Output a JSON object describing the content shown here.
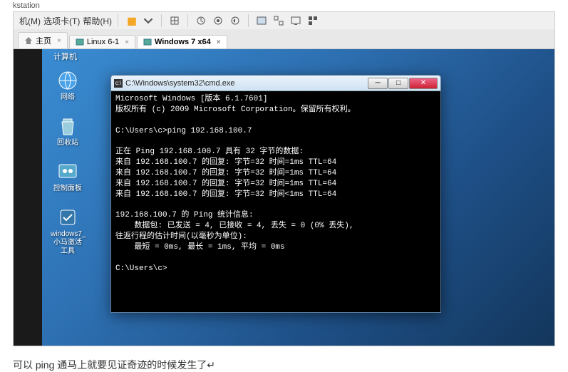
{
  "app_header": "kstation",
  "menu": {
    "item1": "机(M)",
    "item2": "选项卡(T)",
    "item3": "帮助(H)"
  },
  "tabs": {
    "home": "主页",
    "linux": "Linux 6-1",
    "win7": "Windows 7 x64"
  },
  "sec_title": "计算机",
  "desktop": {
    "network": "网络",
    "recycle": "回收站",
    "control": "控制面板",
    "tool": "windows7_小马激活工具"
  },
  "cmd": {
    "title": "C:\\Windows\\system32\\cmd.exe",
    "lines": [
      "Microsoft Windows [版本 6.1.7601]",
      "版权所有 (c) 2009 Microsoft Corporation。保留所有权利。",
      "",
      "C:\\Users\\c>ping 192.168.100.7",
      "",
      "正在 Ping 192.168.100.7 具有 32 字节的数据:",
      "来自 192.168.100.7 的回复: 字节=32 时间=1ms TTL=64",
      "来自 192.168.100.7 的回复: 字节=32 时间=1ms TTL=64",
      "来自 192.168.100.7 的回复: 字节=32 时间=1ms TTL=64",
      "来自 192.168.100.7 的回复: 字节=32 时间<1ms TTL=64",
      "",
      "192.168.100.7 的 Ping 统计信息:",
      "    数据包: 已发送 = 4, 已接收 = 4, 丢失 = 0 (0% 丢失),",
      "往返行程的估计时间(以毫秒为单位):",
      "    最短 = 0ms, 最长 = 1ms, 平均 = 0ms",
      "",
      "C:\\Users\\c>"
    ]
  },
  "caption": "可以 ping 通马上就要见证奇迹的时候发生了↵"
}
